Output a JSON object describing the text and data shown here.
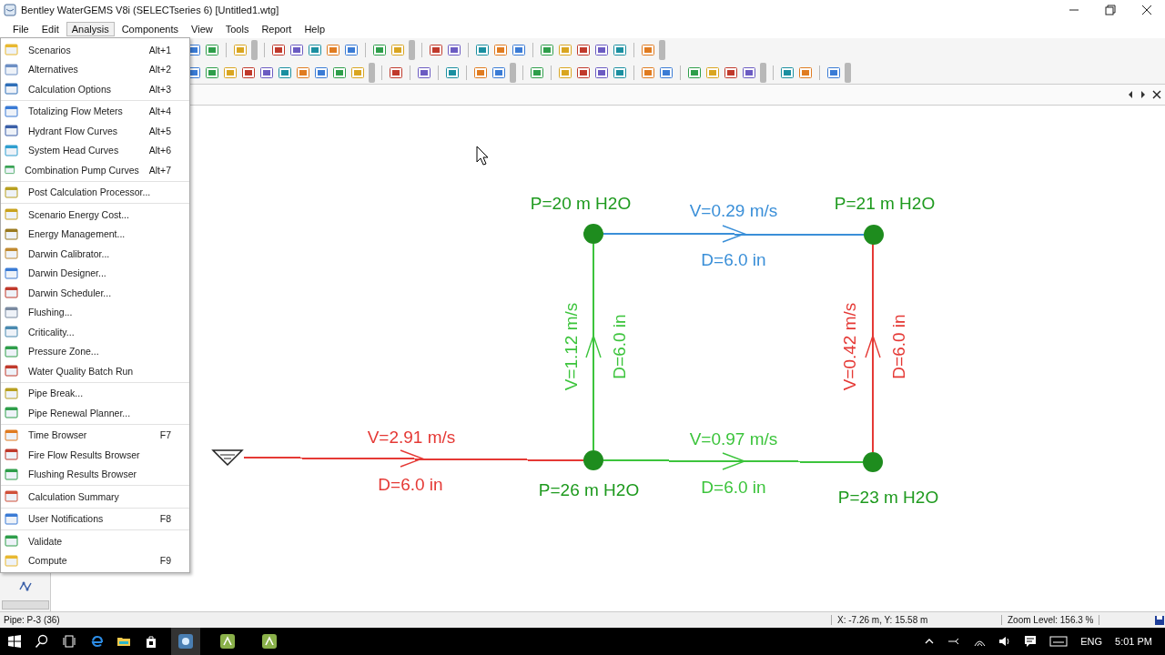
{
  "window": {
    "title": "Bentley WaterGEMS V8i (SELECTseries 6) [Untitled1.wtg]"
  },
  "menu_bar": [
    {
      "label": "File",
      "selected": false
    },
    {
      "label": "Edit",
      "selected": false
    },
    {
      "label": "Analysis",
      "selected": true
    },
    {
      "label": "Components",
      "selected": false
    },
    {
      "label": "View",
      "selected": false
    },
    {
      "label": "Tools",
      "selected": false
    },
    {
      "label": "Report",
      "selected": false
    },
    {
      "label": "Help",
      "selected": false
    }
  ],
  "analysis_menu": {
    "groups": [
      [
        {
          "label": "Scenarios",
          "shortcut": "Alt+1"
        },
        {
          "label": "Alternatives",
          "shortcut": "Alt+2"
        },
        {
          "label": "Calculation Options",
          "shortcut": "Alt+3"
        }
      ],
      [
        {
          "label": "Totalizing Flow Meters",
          "shortcut": "Alt+4"
        },
        {
          "label": "Hydrant Flow Curves",
          "shortcut": "Alt+5"
        },
        {
          "label": "System Head Curves",
          "shortcut": "Alt+6"
        },
        {
          "label": "Combination Pump Curves",
          "shortcut": "Alt+7"
        }
      ],
      [
        {
          "label": "Post Calculation Processor..."
        }
      ],
      [
        {
          "label": "Scenario Energy Cost..."
        },
        {
          "label": "Energy Management..."
        },
        {
          "label": "Darwin Calibrator..."
        },
        {
          "label": "Darwin Designer..."
        },
        {
          "label": "Darwin Scheduler..."
        },
        {
          "label": "Flushing..."
        },
        {
          "label": "Criticality..."
        },
        {
          "label": "Pressure Zone..."
        },
        {
          "label": "Water Quality Batch Run"
        }
      ],
      [
        {
          "label": "Pipe Break..."
        },
        {
          "label": "Pipe Renewal Planner..."
        }
      ],
      [
        {
          "label": "Time Browser",
          "shortcut": "F7"
        },
        {
          "label": "Fire Flow Results Browser"
        },
        {
          "label": "Flushing Results Browser"
        }
      ],
      [
        {
          "label": "Calculation Summary"
        }
      ],
      [
        {
          "label": "User Notifications",
          "shortcut": "F8"
        }
      ],
      [
        {
          "label": "Validate"
        },
        {
          "label": "Compute",
          "shortcut": "F9"
        }
      ]
    ]
  },
  "network": {
    "pipes": [
      {
        "velocity": "V=2.91 m/s",
        "diameter": "D=6.0 in",
        "color": "#e53935"
      },
      {
        "velocity": "V=0.29 m/s",
        "diameter": "D=6.0 in",
        "color": "#3a8fd8"
      },
      {
        "velocity": "V=1.12 m/s",
        "diameter": "D=6.0 in",
        "color": "#3cc43c"
      },
      {
        "velocity": "V=0.42 m/s",
        "diameter": "D=6.0 in",
        "color": "#e53935"
      },
      {
        "velocity": "V=0.97 m/s",
        "diameter": "D=6.0 in",
        "color": "#3cc43c"
      }
    ],
    "junctions": [
      {
        "pressure": "P=20 m H2O"
      },
      {
        "pressure": "P=21 m H2O"
      },
      {
        "pressure": "P=26 m H2O"
      },
      {
        "pressure": "P=23 m H2O"
      }
    ]
  },
  "status_bar": {
    "element": "Pipe: P-3 (36)",
    "coordinates": "X: -7.26 m, Y: 15.58 m",
    "zoom": "Zoom Level: 156.3 %"
  },
  "taskbar": {
    "language": "ENG",
    "time": "5:01 PM"
  }
}
